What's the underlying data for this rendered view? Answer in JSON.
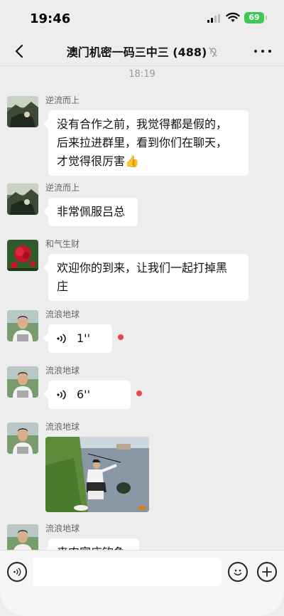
{
  "status_bar": {
    "time": "19:46",
    "battery": "69"
  },
  "header": {
    "title": "澳门机密一码三中三 (488)"
  },
  "chat": {
    "timestamp": "18:19",
    "messages": [
      {
        "sender": "逆流而上",
        "type": "text",
        "lines": [
          "没有合作之前，我觉得都是假的，",
          "后来拉进群里，看到你们在聊天，",
          "才觉得很厉害"
        ],
        "emoji": "👍"
      },
      {
        "sender": "逆流而上",
        "type": "text",
        "lines": [
          "非常佩服吕总"
        ]
      },
      {
        "sender": "和气生财",
        "type": "text",
        "lines": [
          "欢迎你的到来，让我们一起打掉黑",
          "庄"
        ]
      },
      {
        "sender": "流浪地球",
        "type": "voice",
        "duration": "1''"
      },
      {
        "sender": "流浪地球",
        "type": "voice",
        "duration": "6''"
      },
      {
        "sender": "流浪地球",
        "type": "image"
      },
      {
        "sender": "流浪地球",
        "type": "text",
        "lines": [
          "来肉家庄钓鱼"
        ]
      }
    ]
  },
  "colors": {
    "unread_dot": "#e5484d",
    "battery": "#3dc854",
    "background": "#ededed"
  },
  "icons": [
    "back-arrow-icon",
    "more-dots-icon",
    "mute-ear-icon",
    "voice-wave-icon",
    "voice-input-icon",
    "emoji-icon",
    "add-icon"
  ]
}
